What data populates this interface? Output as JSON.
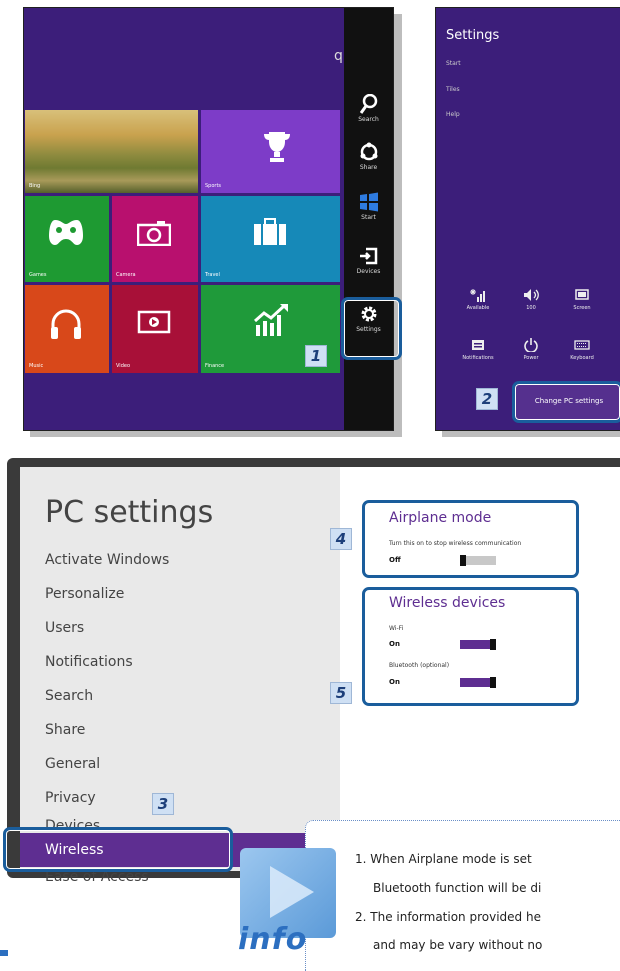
{
  "start_screen": {
    "search_letter": "q",
    "tiles": {
      "bing": "Bing",
      "sports": "Sports",
      "games": "Games",
      "camera": "Camera",
      "travel": "Travel",
      "music": "Music",
      "video": "Video",
      "finance": "Finance"
    },
    "charms": {
      "search": "Search",
      "share": "Share",
      "start": "Start",
      "devices": "Devices",
      "settings": "Settings"
    },
    "step_number": "1"
  },
  "settings_charm": {
    "title": "Settings",
    "links": [
      "Start",
      "Tiles",
      "Help"
    ],
    "quick": {
      "available": "Available",
      "volume": "100",
      "screen": "Screen",
      "notifications": "Notifications",
      "power": "Power",
      "keyboard": "Keyboard"
    },
    "change_pc_settings": "Change PC settings",
    "step_number": "2"
  },
  "pc_settings": {
    "title": "PC settings",
    "menu": [
      "Activate Windows",
      "Personalize",
      "Users",
      "Notifications",
      "Search",
      "Share",
      "General",
      "Privacy",
      "Devices",
      "Wireless",
      "Ease of Access"
    ],
    "airplane": {
      "heading": "Airplane mode",
      "desc": "Turn this on to stop wireless communication",
      "value": "Off"
    },
    "wireless": {
      "heading": "Wireless devices",
      "wifi_label": "Wi-Fi",
      "wifi_value": "On",
      "bt_label_main": "Bluetooth",
      "bt_label_opt": "(optional)",
      "bt_value": "On"
    },
    "step3": "3",
    "step4": "4",
    "step5": "5"
  },
  "info": {
    "badge": "info",
    "line1": "1. When Airplane mode is set",
    "line2": "Bluetooth function will be di",
    "line3": "2. The information provided he",
    "line4": "and may be vary without no"
  },
  "colors": {
    "start_bg": "#3c1e7a",
    "accent": "#5e2e91",
    "highlight": "#1a5d9c"
  }
}
